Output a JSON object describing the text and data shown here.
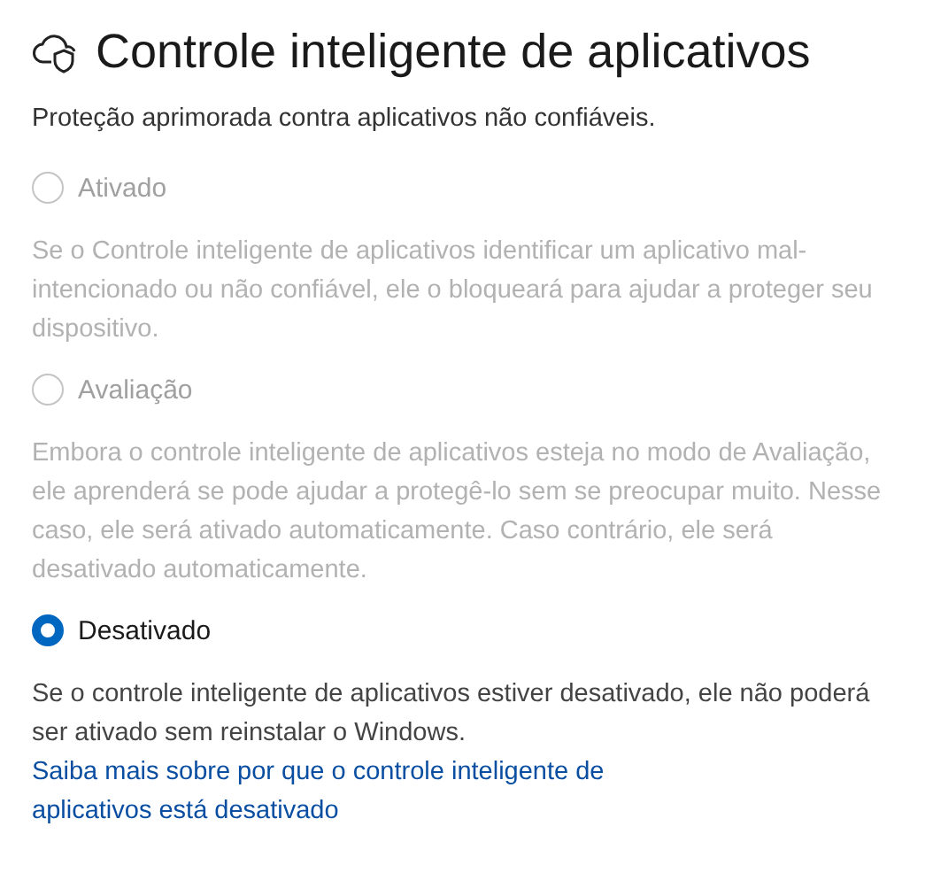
{
  "header": {
    "title": "Controle inteligente de aplicativos",
    "subtitle": "Proteção aprimorada contra aplicativos não confiáveis."
  },
  "options": [
    {
      "label": "Ativado",
      "selected": false,
      "disabled": true,
      "description": "Se o Controle inteligente de aplicativos identificar um aplicativo mal-intencionado ou não confiável, ele o bloqueará para ajudar a proteger seu dispositivo."
    },
    {
      "label": "Avaliação",
      "selected": false,
      "disabled": true,
      "description": "Embora o controle inteligente de aplicativos esteja no modo de Avaliação, ele aprenderá se pode ajudar a protegê-lo sem se preocupar muito. Nesse caso, ele será ativado automaticamente. Caso contrário, ele será desativado automaticamente."
    },
    {
      "label": "Desativado",
      "selected": true,
      "disabled": false,
      "description": "Se o controle inteligente de aplicativos estiver desativado, ele não poderá ser ativado sem reinstalar o Windows."
    }
  ],
  "link": "Saiba mais sobre por que o controle inteligente de aplicativos está desativado"
}
